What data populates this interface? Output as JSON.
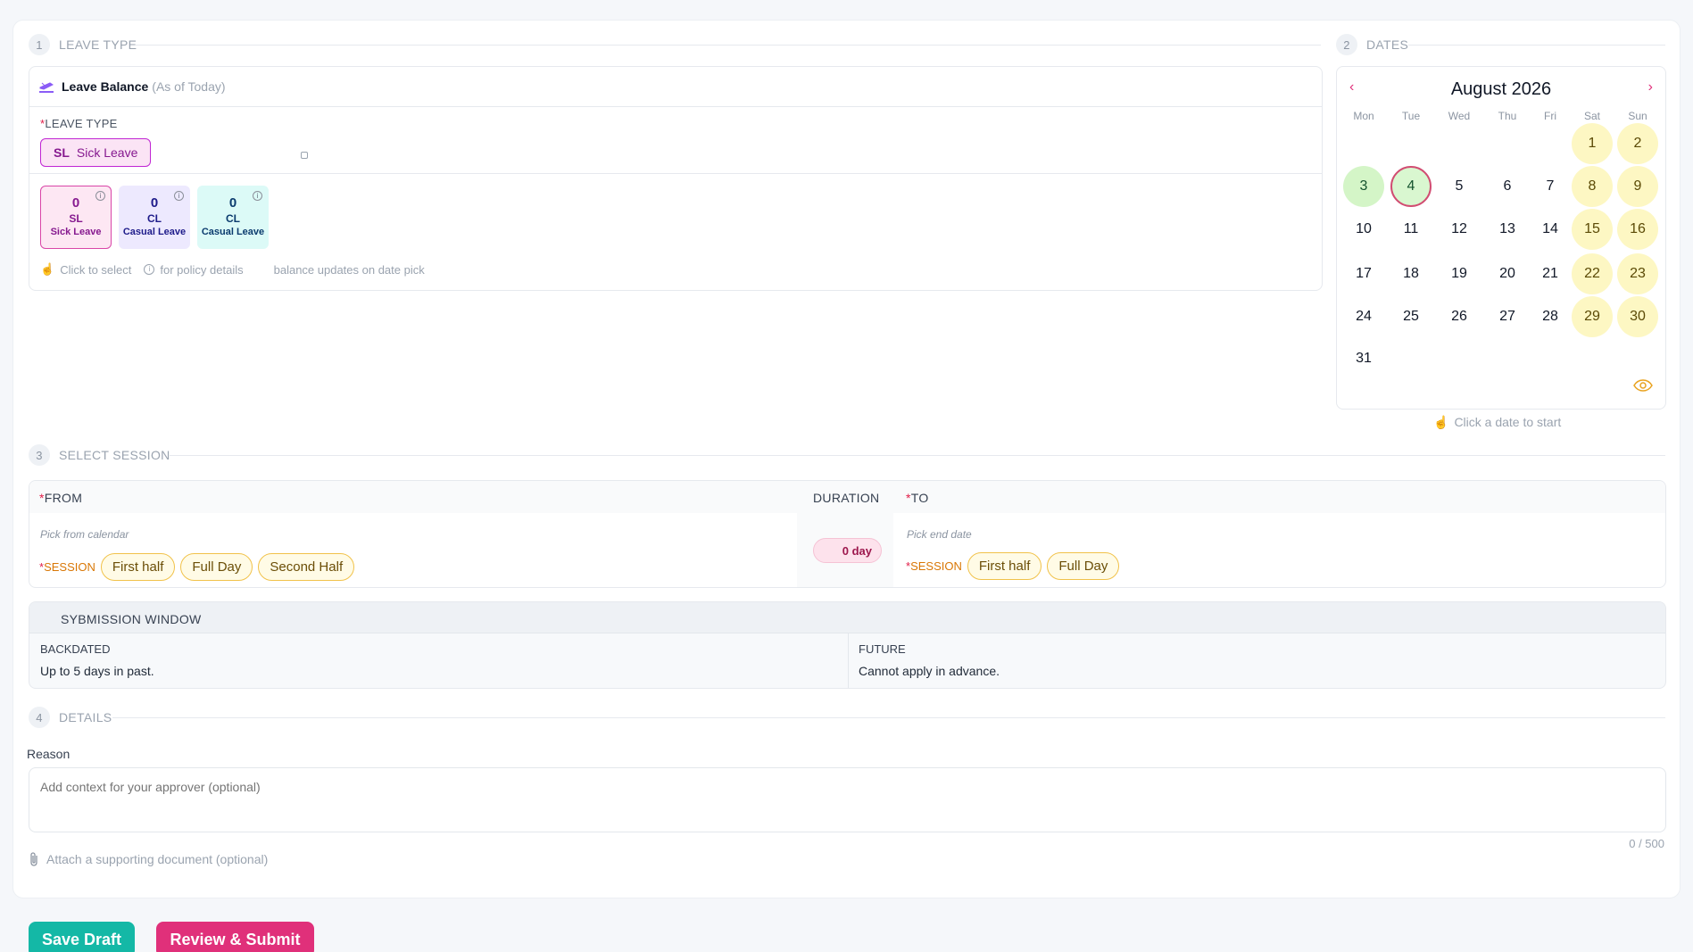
{
  "steps": {
    "leave_type": {
      "num": "1",
      "label": "LEAVE TYPE"
    },
    "dates": {
      "num": "2",
      "label": "DATES"
    },
    "session": {
      "num": "3",
      "label": "SELECT SESSION"
    },
    "details": {
      "num": "4",
      "label": "DETAILS"
    }
  },
  "balance": {
    "title": "Leave Balance",
    "subtitle": "(As of Today)",
    "leave_type_label": "LEAVE TYPE",
    "selected_code": "SL",
    "selected_name": "Sick Leave",
    "tiles": [
      {
        "count": "0",
        "code": "SL",
        "name": "Sick Leave",
        "bg": "#fde7f3",
        "border": "#d946a8",
        "color": "#86198f"
      },
      {
        "count": "0",
        "code": "CL",
        "name": "Casual Leave",
        "bg": "#ede9fe",
        "border": "#ede9fe",
        "color": "#1e1b8a"
      },
      {
        "count": "0",
        "code": "CL",
        "name": "Casual Leave",
        "bg": "#dcfaf7",
        "border": "#dcfaf7",
        "color": "#0b3b6e"
      }
    ],
    "hint_click": "Click to select",
    "hint_policy": "for policy details",
    "hint_update": "balance updates on date pick"
  },
  "calendar": {
    "month": "August 2026",
    "dows": [
      "Mon",
      "Tue",
      "Wed",
      "Thu",
      "Fri",
      "Sat",
      "Sun"
    ],
    "hint": "Click a date to start"
  },
  "session": {
    "from_label": "FROM",
    "from_placeholder": "Pick from calendar",
    "session_label": "SESSION",
    "from_options": [
      "First half",
      "Full Day",
      "Second Half"
    ],
    "duration_label": "DURATION",
    "duration_value": "0 day",
    "to_label": "TO",
    "to_placeholder": "Pick end date",
    "to_options": [
      "First half",
      "Full Day"
    ]
  },
  "window": {
    "title": "SYBMISSION WINDOW",
    "backdated_label": "BACKDATED",
    "backdated_text": "Up to 5 days in past.",
    "future_label": "FUTURE",
    "future_text": "Cannot apply in advance."
  },
  "details": {
    "reason_label": "Reason",
    "reason_placeholder": "Add context for your approver (optional)",
    "counter": "0 / 500",
    "attach": "Attach a supporting document (optional)"
  },
  "actions": {
    "save_draft": "Save Draft",
    "review_submit": "Review & Submit"
  },
  "colors": {
    "accent_teal": "#14b8a6",
    "accent_pink": "#e0307a",
    "weekend": "#fdf7c3"
  }
}
